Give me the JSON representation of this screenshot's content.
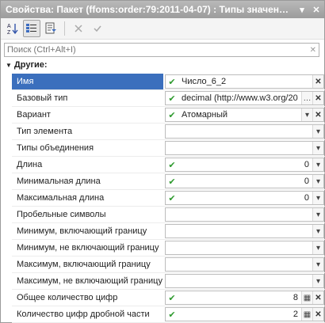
{
  "window": {
    "title": "Свойства: Пакет (ffoms:order:79:2011-04-07) : Типы значен…"
  },
  "toolbar": {
    "sort_icon": "sort-az-icon",
    "categories_icon": "categories-icon",
    "filter_icon": "filter-icon",
    "clear_icon": "close-icon",
    "apply_icon": "check-icon"
  },
  "search": {
    "placeholder": "Поиск (Ctrl+Alt+I)"
  },
  "group": {
    "label": "Другие:"
  },
  "properties": [
    {
      "name": "Имя",
      "value": "Число_6_2",
      "kind": "text-clear"
    },
    {
      "name": "Базовый тип",
      "value": "decimal (http://www.w3.org/20",
      "kind": "text-more-clear"
    },
    {
      "name": "Вариант",
      "value": "Атомарный",
      "kind": "dropdown-clear"
    },
    {
      "name": "Тип элемента",
      "value": "",
      "kind": "empty"
    },
    {
      "name": "Типы объединения",
      "value": "",
      "kind": "empty"
    },
    {
      "name": "Длина",
      "value": "0",
      "kind": "number"
    },
    {
      "name": "Минимальная длина",
      "value": "0",
      "kind": "number"
    },
    {
      "name": "Максимальная длина",
      "value": "0",
      "kind": "number"
    },
    {
      "name": "Пробельные символы",
      "value": "",
      "kind": "empty"
    },
    {
      "name": "Минимум, включающий границу",
      "value": "",
      "kind": "empty"
    },
    {
      "name": "Минимум, не включающий границу",
      "value": "",
      "kind": "empty"
    },
    {
      "name": "Максимум, включающий границу",
      "value": "",
      "kind": "empty"
    },
    {
      "name": "Максимум, не включающий границу",
      "value": "",
      "kind": "empty"
    },
    {
      "name": "Общее количество цифр",
      "value": "8",
      "kind": "number-calc"
    },
    {
      "name": "Количество цифр дробной части",
      "value": "2",
      "kind": "number-calc"
    }
  ],
  "colors": {
    "selection": "#3b6fbd",
    "check": "#2e9a2e",
    "titlebar": "#a9a9a9"
  }
}
